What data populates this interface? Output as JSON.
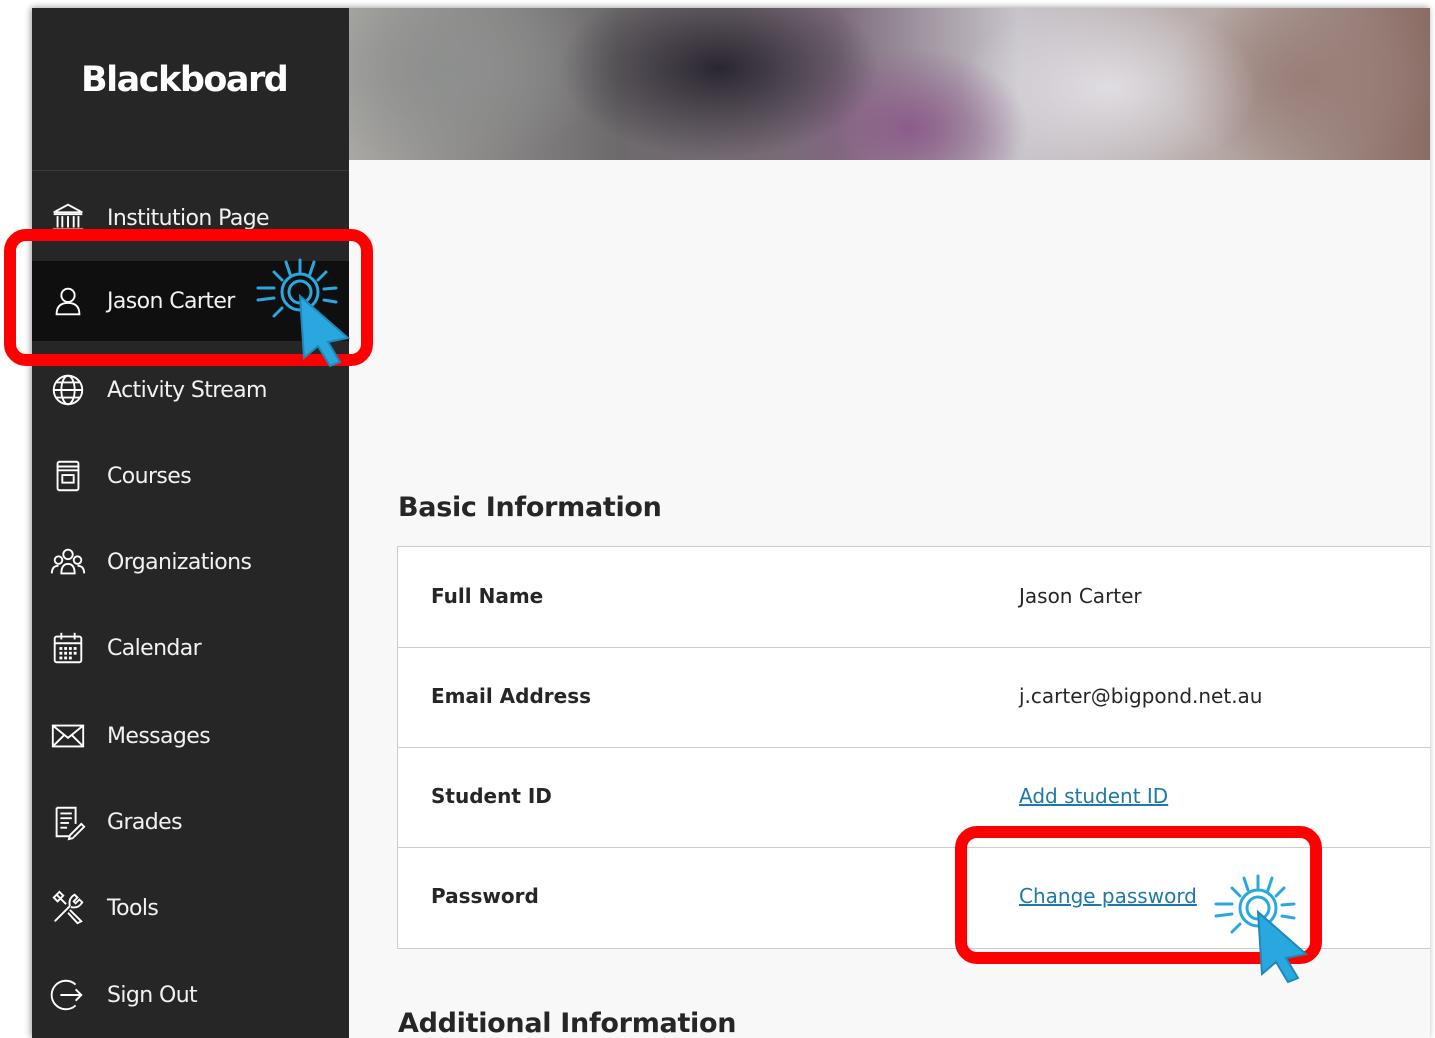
{
  "brand": {
    "name": "Blackboard"
  },
  "sidebar": {
    "items": [
      {
        "label": "Institution Page",
        "icon": "institution-icon"
      },
      {
        "label": "Jason Carter",
        "icon": "user-icon",
        "active": true
      },
      {
        "label": "Activity Stream",
        "icon": "globe-icon"
      },
      {
        "label": "Courses",
        "icon": "courses-icon"
      },
      {
        "label": "Organizations",
        "icon": "organizations-icon"
      },
      {
        "label": "Calendar",
        "icon": "calendar-icon"
      },
      {
        "label": "Messages",
        "icon": "envelope-icon"
      },
      {
        "label": "Grades",
        "icon": "grades-icon"
      },
      {
        "label": "Tools",
        "icon": "tools-icon"
      },
      {
        "label": "Sign Out",
        "icon": "sign-out-icon"
      }
    ]
  },
  "basic_info": {
    "title": "Basic Information",
    "rows": [
      {
        "label": "Full Name",
        "value": "Jason Carter"
      },
      {
        "label": "Email Address",
        "value": "j.carter@bigpond.net.au"
      },
      {
        "label": "Student ID",
        "value": "Add student ID"
      },
      {
        "label": "Password",
        "value": "Change password"
      }
    ]
  },
  "additional_info": {
    "title": "Additional Information"
  },
  "colors": {
    "sidebar_bg": "#262626",
    "active_item_bg": "#0f0f0f",
    "link": "#1e78a8",
    "highlight": "#ff0000",
    "click_cursor": "#29a8e0"
  }
}
